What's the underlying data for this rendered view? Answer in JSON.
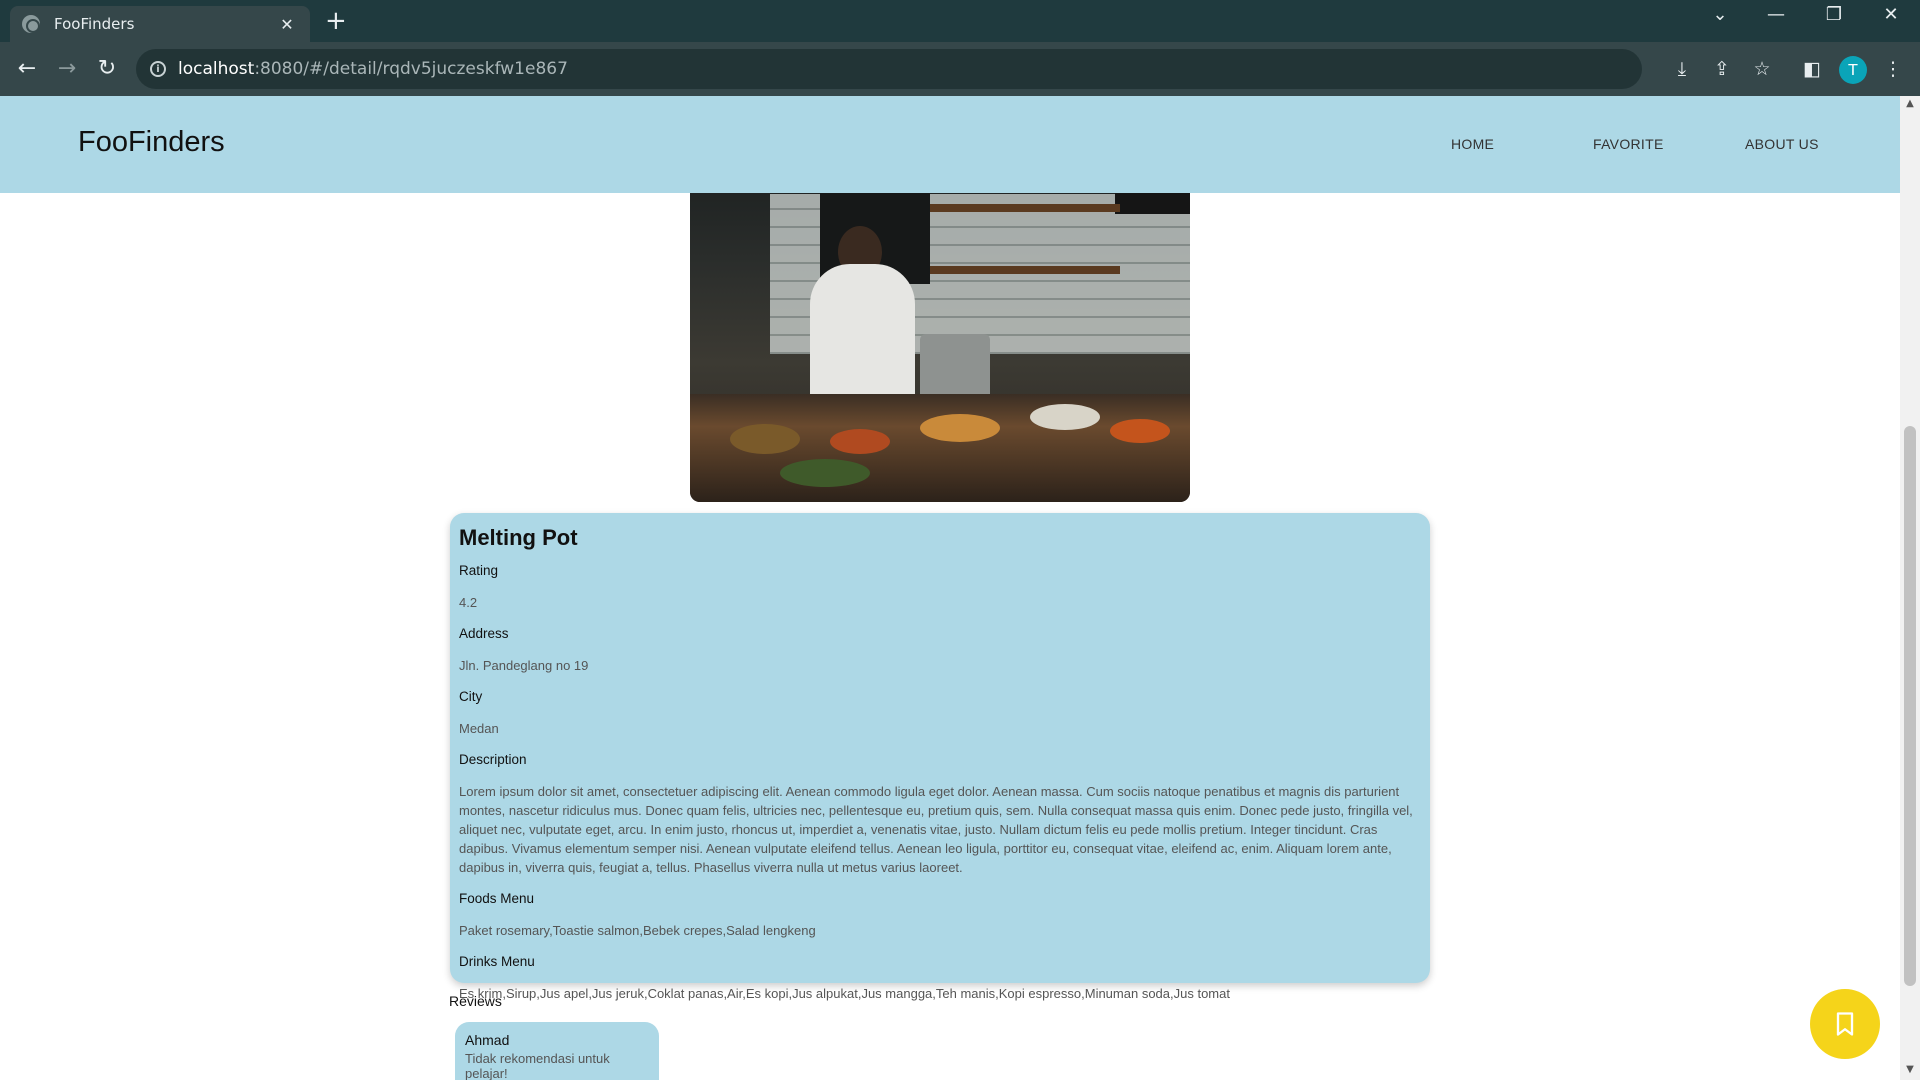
{
  "browser": {
    "tab_title": "FooFinders",
    "url_host": "localhost",
    "url_path": ":8080/#/detail/rqdv5juczeskfw1e867",
    "profile_initial": "T"
  },
  "site": {
    "brand": "FooFinders",
    "nav": [
      "HOME",
      "FAVORITE",
      "ABOUT US"
    ]
  },
  "restaurant": {
    "name": "Melting Pot",
    "rating_label": "Rating",
    "rating": "4.2",
    "address_label": "Address",
    "address": "Jln. Pandeglang no 19",
    "city_label": "City",
    "city": "Medan",
    "description_label": "Description",
    "description": "Lorem ipsum dolor sit amet, consectetuer adipiscing elit. Aenean commodo ligula eget dolor. Aenean massa. Cum sociis natoque penatibus et magnis dis parturient montes, nascetur ridiculus mus. Donec quam felis, ultricies nec, pellentesque eu, pretium quis, sem. Nulla consequat massa quis enim. Donec pede justo, fringilla vel, aliquet nec, vulputate eget, arcu. In enim justo, rhoncus ut, imperdiet a, venenatis vitae, justo. Nullam dictum felis eu pede mollis pretium. Integer tincidunt. Cras dapibus. Vivamus elementum semper nisi. Aenean vulputate eleifend tellus. Aenean leo ligula, porttitor eu, consequat vitae, eleifend ac, enim. Aliquam lorem ante, dapibus in, viverra quis, feugiat a, tellus. Phasellus viverra nulla ut metus varius laoreet.",
    "foods_label": "Foods Menu",
    "foods": "Paket rosemary,Toastie salmon,Bebek crepes,Salad lengkeng",
    "drinks_label": "Drinks Menu",
    "drinks": "Es krim,Sirup,Jus apel,Jus jeruk,Coklat panas,Air,Es kopi,Jus alpukat,Jus mangga,Teh manis,Kopi espresso,Minuman soda,Jus tomat"
  },
  "reviews": {
    "title": "Reviews",
    "items": [
      {
        "name": "Ahmad",
        "text": "Tidak rekomendasi untuk pelajar!"
      }
    ]
  },
  "colors": {
    "header_bg": "#add8e6",
    "card_bg": "#add8e6",
    "fab_bg": "#f5d41a",
    "chrome_bg": "#35474a"
  }
}
